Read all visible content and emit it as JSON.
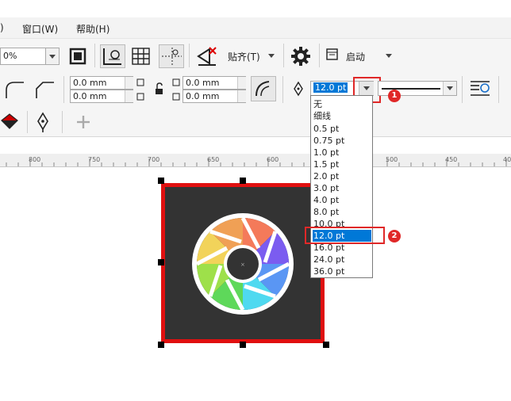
{
  "menu": {
    "paren_fragment": ")",
    "window_label": "窗口(W)",
    "help_label": "帮助(H)"
  },
  "toolbar1": {
    "zoom_value": "0%",
    "align_label": "贴齐(T)",
    "launch_label": "启动"
  },
  "toolbar2": {
    "pos_x1": "0.0 mm",
    "pos_y1": "0.0 mm",
    "pos_x2": "0.0 mm",
    "pos_y2": "0.0 mm",
    "outline_width_value": "12.0 pt"
  },
  "dropdown": {
    "items": [
      "无",
      "细线",
      "0.5 pt",
      "0.75 pt",
      "1.0 pt",
      "1.5 pt",
      "2.0 pt",
      "3.0 pt",
      "4.0 pt",
      "8.0 pt",
      "10.0 pt",
      "12.0 pt",
      "16.0 pt",
      "24.0 pt",
      "36.0 pt"
    ],
    "selected": "12.0 pt"
  },
  "ruler": {
    "ticks": [
      "800",
      "750",
      "700",
      "650",
      "600",
      "500",
      "450",
      "40"
    ]
  },
  "callouts": {
    "one": "1",
    "two": "2"
  },
  "colors": {
    "selection": "#0078d7",
    "highlight_border": "#e02828",
    "object_fill": "#333333",
    "object_outline": "#e01010"
  }
}
